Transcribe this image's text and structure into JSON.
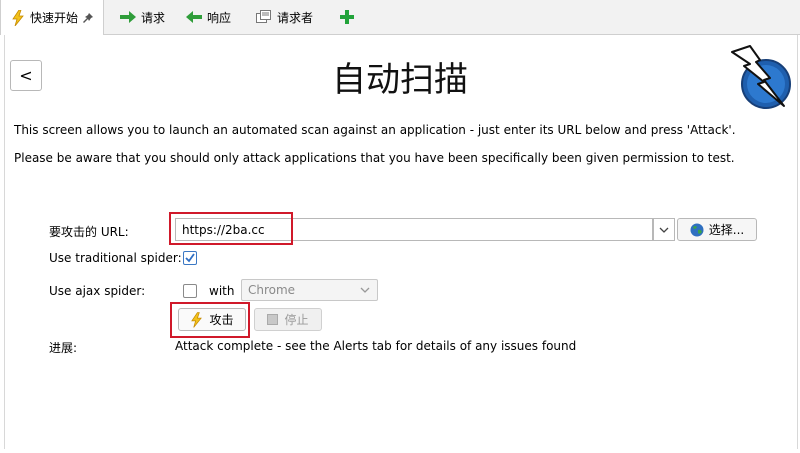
{
  "tabs": [
    {
      "label": "快速开始",
      "icon": "lightning-icon",
      "active": true
    },
    {
      "label": "请求",
      "icon": "arrow-right-icon"
    },
    {
      "label": "响应",
      "icon": "arrow-left-icon"
    },
    {
      "label": "请求者",
      "icon": "requester-icon"
    }
  ],
  "add_tab_icon": "plus-icon",
  "page": {
    "back_label": "<",
    "title": "自动扫描",
    "description_1": "This screen allows you to launch an automated scan against  an application - just enter its URL below and press 'Attack'.",
    "description_2": "Please be aware that you should only attack applications that you have been specifically been given permission to test."
  },
  "form": {
    "url_label": "要攻击的 URL:",
    "url_value": "https://2ba.cc",
    "select_label": "选择...",
    "traditional_spider_label": "Use traditional spider:",
    "traditional_spider_checked": true,
    "ajax_spider_label": "Use ajax spider:",
    "ajax_spider_checked": false,
    "with_label": "with",
    "browser_value": "Chrome",
    "attack_label": "攻击",
    "stop_label": "停止",
    "progress_label": "进展:",
    "progress_value": "Attack complete - see the Alerts tab for details of any issues found"
  },
  "colors": {
    "highlight": "#d0192a",
    "accent": "#1f6fc2",
    "add": "#22a33a"
  }
}
